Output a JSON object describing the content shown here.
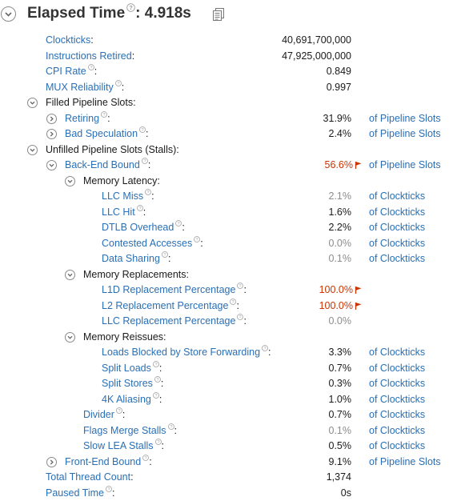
{
  "header": {
    "title": "Elapsed Time",
    "sep": ":",
    "value": "4.918s"
  },
  "rows": [
    {
      "label": "Clockticks",
      "link": true,
      "help": false,
      "value": "40,691,700,000"
    },
    {
      "label": "Instructions Retired",
      "link": true,
      "help": false,
      "value": "47,925,000,000"
    },
    {
      "label": "CPI Rate",
      "link": true,
      "help": true,
      "value": "0.849"
    },
    {
      "label": "MUX Reliability",
      "link": true,
      "help": true,
      "value": "0.997"
    },
    {
      "label": "Filled Pipeline Slots",
      "link": false,
      "help": false,
      "expander": "expanded"
    },
    {
      "label": "Retiring",
      "link": true,
      "help": true,
      "expander": "collapsed",
      "value": "31.9%",
      "unit": "of Pipeline Slots"
    },
    {
      "label": "Bad Speculation",
      "link": true,
      "help": true,
      "expander": "collapsed",
      "value": "2.4%",
      "unit": "of Pipeline Slots"
    },
    {
      "label": "Unfilled Pipeline Slots (Stalls)",
      "link": false,
      "help": false,
      "expander": "expanded"
    },
    {
      "label": "Back-End Bound",
      "link": true,
      "help": true,
      "expander": "expanded",
      "value": "56.6%",
      "warn": true,
      "unit": "of Pipeline Slots"
    },
    {
      "label": "Memory Latency",
      "link": false,
      "help": false,
      "expander": "expanded"
    },
    {
      "label": "LLC Miss",
      "link": true,
      "help": true,
      "value": "2.1%",
      "dim": true,
      "unit": "of Clockticks"
    },
    {
      "label": "LLC Hit",
      "link": true,
      "help": true,
      "value": "1.6%",
      "unit": "of Clockticks"
    },
    {
      "label": "DTLB Overhead",
      "link": true,
      "help": true,
      "value": "2.2%",
      "unit": "of Clockticks"
    },
    {
      "label": "Contested Accesses",
      "link": true,
      "help": true,
      "value": "0.0%",
      "dim": true,
      "unit": "of Clockticks"
    },
    {
      "label": "Data Sharing",
      "link": true,
      "help": true,
      "value": "0.1%",
      "dim": true,
      "unit": "of Clockticks"
    },
    {
      "label": "Memory Replacements",
      "link": false,
      "help": false,
      "expander": "expanded"
    },
    {
      "label": "L1D Replacement Percentage",
      "link": true,
      "help": true,
      "value": "100.0%",
      "warn": true
    },
    {
      "label": "L2 Replacement Percentage",
      "link": true,
      "help": true,
      "value": "100.0%",
      "warn": true
    },
    {
      "label": "LLC Replacement Percentage",
      "link": true,
      "help": true,
      "value": "0.0%",
      "dim": true
    },
    {
      "label": "Memory Reissues",
      "link": false,
      "help": false,
      "expander": "expanded"
    },
    {
      "label": "Loads Blocked by Store Forwarding",
      "link": true,
      "help": true,
      "value": "3.3%",
      "unit": "of Clockticks"
    },
    {
      "label": "Split Loads",
      "link": true,
      "help": true,
      "value": "0.7%",
      "unit": "of Clockticks"
    },
    {
      "label": "Split Stores",
      "link": true,
      "help": true,
      "value": "0.3%",
      "unit": "of Clockticks"
    },
    {
      "label": "4K Aliasing",
      "link": true,
      "help": true,
      "value": "1.0%",
      "unit": "of Clockticks"
    },
    {
      "label": "Divider",
      "link": true,
      "help": true,
      "value": "0.7%",
      "unit": "of Clockticks"
    },
    {
      "label": "Flags Merge Stalls",
      "link": true,
      "help": true,
      "value": "0.1%",
      "dim": true,
      "unit": "of Clockticks"
    },
    {
      "label": "Slow LEA Stalls",
      "link": true,
      "help": true,
      "value": "0.5%",
      "unit": "of Clockticks"
    },
    {
      "label": "Front-End Bound",
      "link": true,
      "help": true,
      "expander": "collapsed",
      "value": "9.1%",
      "unit": "of Pipeline Slots"
    },
    {
      "label": "Total Thread Count",
      "link": true,
      "help": false,
      "value": "1,374"
    },
    {
      "label": "Paused Time",
      "link": true,
      "help": true,
      "value": "0s"
    }
  ],
  "icons": {
    "help": "question-mark-icon",
    "warning": "red-flag-icon",
    "copy": "copy-document-icon",
    "expanded": "chevron-down-icon",
    "collapsed": "chevron-right-icon"
  },
  "colors": {
    "link": "#2a6fb5",
    "warning": "#cc3300",
    "dim": "#8c8c8c"
  }
}
